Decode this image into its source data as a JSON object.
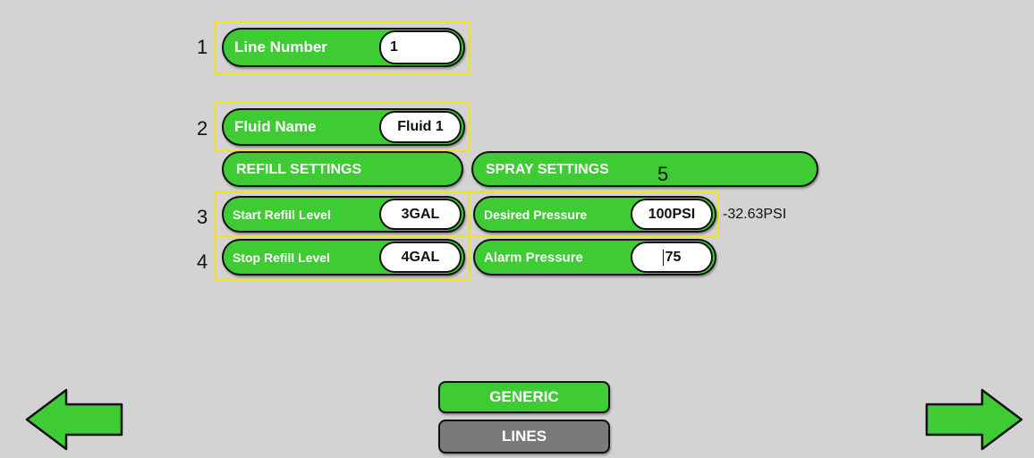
{
  "markers": [
    "1",
    "2",
    "3",
    "4",
    "5"
  ],
  "line_number": {
    "label": "Line Number",
    "value": "1"
  },
  "fluid_name": {
    "label": "Fluid Name",
    "value": "Fluid 1"
  },
  "refill_settings": {
    "header": "REFILL SETTINGS",
    "start_refill": {
      "label": "Start Refill Level",
      "value": "3GAL"
    },
    "stop_refill": {
      "label": "Stop Refill Level",
      "value": "4GAL"
    }
  },
  "spray_settings": {
    "header": "SPRAY SETTINGS",
    "desired_pressure": {
      "label": "Desired Pressure",
      "value": "100PSI",
      "reading": "-32.63PSI"
    },
    "alarm_pressure": {
      "label": "Alarm Pressure",
      "value": "75"
    }
  },
  "nav": {
    "generic": "GENERIC",
    "lines": "LINES"
  },
  "icons": {
    "back": "arrow-left-icon",
    "forward": "arrow-right-icon"
  },
  "colors": {
    "accent_green": "#3ecb33",
    "highlight": "#f2e21c",
    "inactive_gray": "#7a7a7a",
    "background": "#d3d3d3"
  }
}
